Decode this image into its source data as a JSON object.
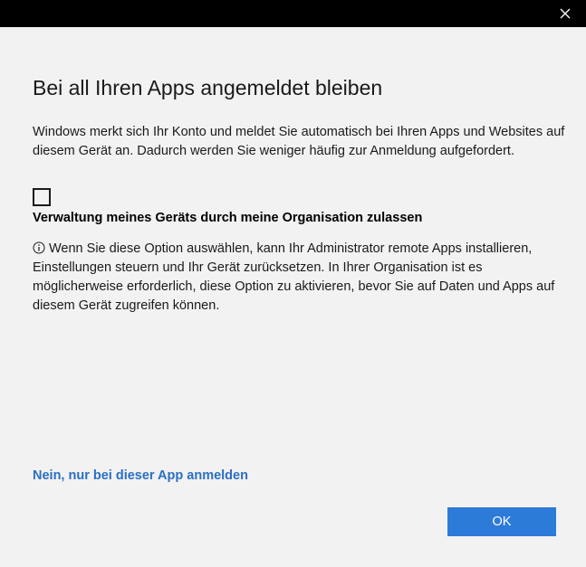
{
  "dialog": {
    "title": "Bei all Ihren Apps angemeldet bleiben",
    "description": "Windows merkt sich Ihr Konto und meldet Sie automatisch bei Ihren Apps und Websites auf diesem Gerät an. Dadurch werden Sie weniger häufig zur Anmeldung aufgefordert.",
    "checkbox": {
      "checked": false,
      "label": "Verwaltung meines Geräts durch meine Organisation zulassen"
    },
    "info_text": "Wenn Sie diese Option auswählen, kann Ihr Administrator remote Apps installieren, Einstellungen steuern und Ihr Gerät zurücksetzen. In Ihrer Organisation ist es möglicherweise erforderlich, diese Option zu aktivieren, bevor Sie auf Daten und Apps auf diesem Gerät zugreifen können.",
    "link_label": "Nein, nur bei dieser App anmelden",
    "ok_label": "OK"
  },
  "icons": {
    "close": "close-icon",
    "info": "info-icon"
  },
  "colors": {
    "titlebar": "#000000",
    "background": "#f2f2f2",
    "link": "#2b6fc2",
    "button": "#2d7bd8",
    "button_text": "#ffffff"
  }
}
